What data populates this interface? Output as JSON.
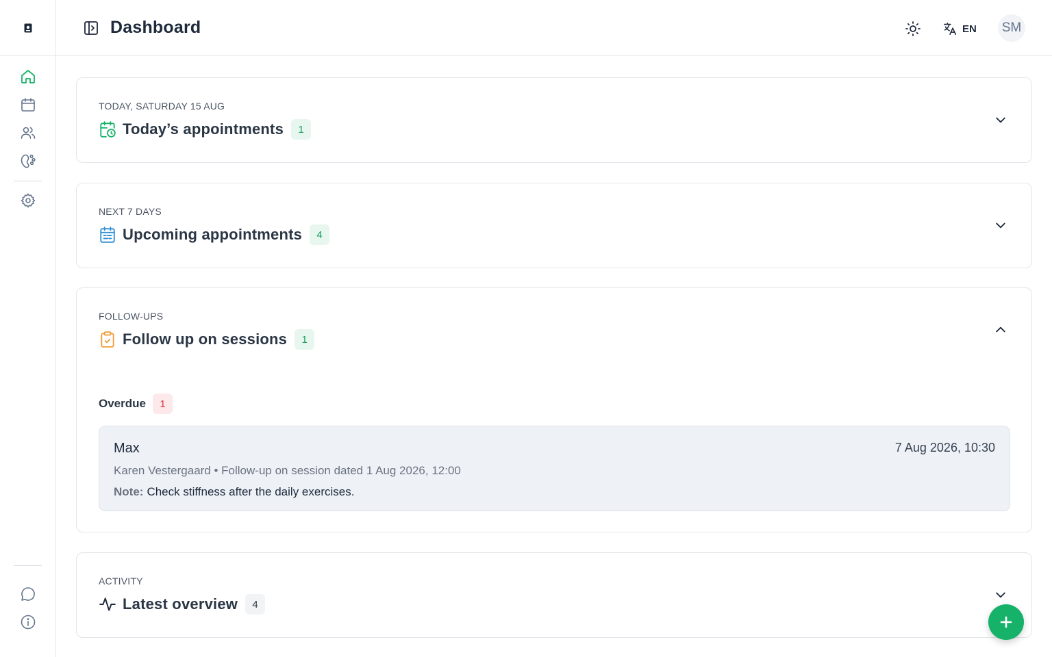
{
  "header": {
    "title": "Dashboard",
    "language": "EN",
    "avatar_initials": "SM"
  },
  "sidebar": {
    "items": [
      {
        "name": "home-icon",
        "active": true
      },
      {
        "name": "calendar-icon",
        "active": false
      },
      {
        "name": "users-icon",
        "active": false
      },
      {
        "name": "paw-icon",
        "active": false
      },
      {
        "name": "settings-icon",
        "active": false
      },
      {
        "name": "chat-icon",
        "active": false
      },
      {
        "name": "info-icon",
        "active": false
      }
    ]
  },
  "sections": {
    "today": {
      "eyebrow": "TODAY, SATURDAY 15 AUG",
      "title": "Today’s appointments",
      "count": "1",
      "expanded": false,
      "icon": "calendar-clock-icon"
    },
    "upcoming": {
      "eyebrow": "NEXT 7 DAYS",
      "title": "Upcoming appointments",
      "count": "4",
      "expanded": false,
      "icon": "calendar-list-icon"
    },
    "followups": {
      "eyebrow": "FOLLOW-UPS",
      "title": "Follow up on sessions",
      "count": "1",
      "expanded": true,
      "icon": "clipboard-check-icon",
      "overdue": {
        "label": "Overdue",
        "count": "1",
        "items": [
          {
            "name": "Max",
            "due": "7 Aug 2026, 10:30",
            "meta": "Karen Vestergaard • Follow-up on session dated 1 Aug 2026, 12:00",
            "note_label": "Note:",
            "note": "Check stiffness after the daily exercises."
          }
        ]
      }
    },
    "activity": {
      "eyebrow": "ACTIVITY",
      "title": "Latest overview",
      "count": "4",
      "expanded": false,
      "icon": "activity-icon"
    }
  },
  "colors": {
    "accent": "#16b26a",
    "blue": "#2f8fd6",
    "orange": "#f29d38",
    "danger": "#e0364a"
  }
}
